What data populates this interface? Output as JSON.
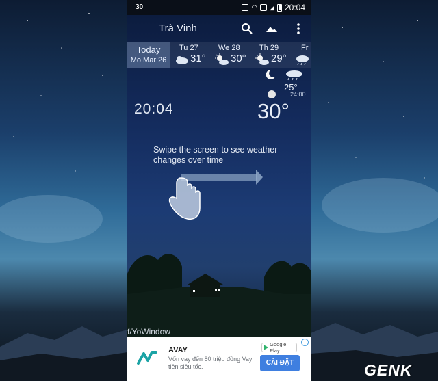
{
  "status_bar": {
    "left_text": "30",
    "time": "20:04"
  },
  "app": {
    "city": "Trà Vinh",
    "today_label": "Today",
    "today_date": "Mo Mar 26",
    "forecast": [
      {
        "day": "Tu 27",
        "temp": "31°",
        "icon": "partly-cloudy-icon"
      },
      {
        "day": "We 28",
        "temp": "30°",
        "icon": "sun-cloud-icon"
      },
      {
        "day": "Th 29",
        "temp": "29°",
        "icon": "sun-cloud-icon"
      },
      {
        "day": "Fr",
        "temp": "",
        "icon": "rain-cloud-icon"
      }
    ],
    "next_temp": "25°",
    "next_time": "24:00",
    "clock": "20:04",
    "current_temp": "30°",
    "hint": "Swipe the screen to see weather changes over time",
    "watermark": "f/YoWindow"
  },
  "ad": {
    "title": "AVAY",
    "description": "Vốn vay đến 80 triệu đồng Vay tiền siêu tốc.",
    "google_play": "Google Play",
    "install_button": "CÀI ĐẶT",
    "info_icon": "i"
  },
  "brand_watermark": "GENK"
}
